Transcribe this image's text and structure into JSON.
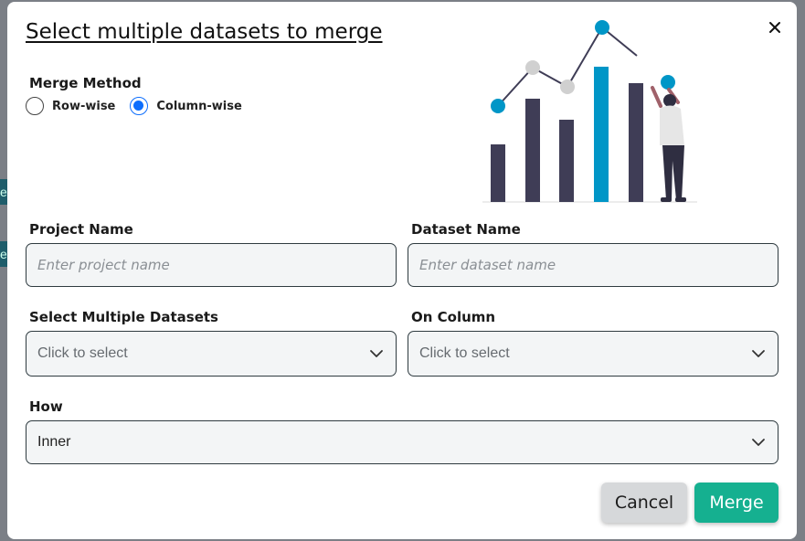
{
  "modal": {
    "title": "Select multiple datasets to merge"
  },
  "merge_method": {
    "label": "Merge Method",
    "options": [
      {
        "label": "Row-wise",
        "selected": false
      },
      {
        "label": "Column-wise",
        "selected": true
      }
    ]
  },
  "project_name": {
    "label": "Project Name",
    "placeholder": "Enter project name",
    "value": ""
  },
  "dataset_name": {
    "label": "Dataset Name",
    "placeholder": "Enter dataset name",
    "value": ""
  },
  "select_datasets": {
    "label": "Select Multiple Datasets",
    "placeholder": "Click to select"
  },
  "on_column": {
    "label": "On Column",
    "placeholder": "Click to select"
  },
  "how": {
    "label": "How",
    "value": "Inner"
  },
  "buttons": {
    "cancel": "Cancel",
    "merge": "Merge"
  },
  "icons": {
    "close": "close-icon",
    "chevron": "chevron-down-icon"
  },
  "colors": {
    "accent": "#0d6efd",
    "merge_button": "#15b090",
    "cancel_button": "#d6d8da",
    "illustration_bar": "#3f3d56",
    "illustration_highlight": "#0096c7"
  }
}
